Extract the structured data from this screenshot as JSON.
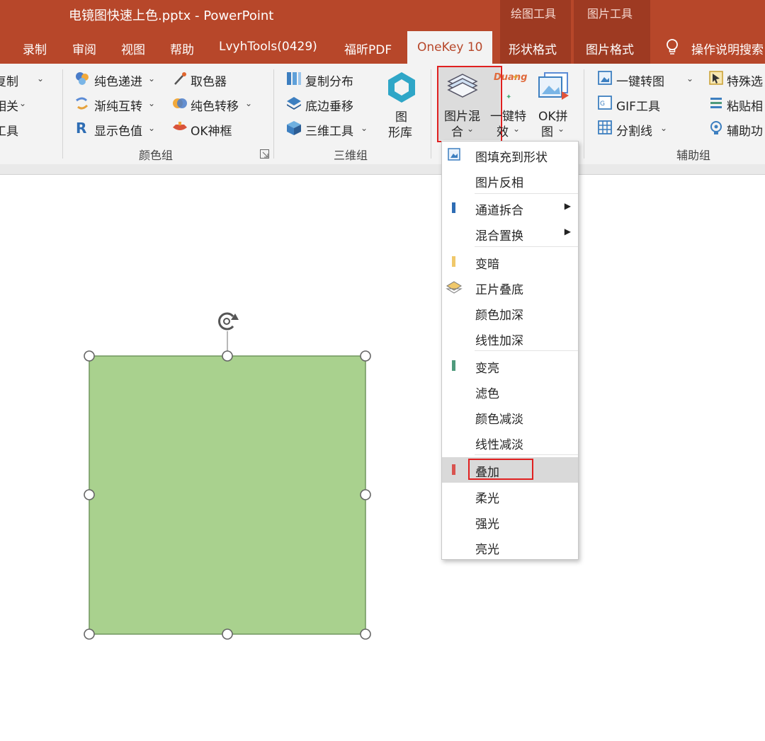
{
  "window": {
    "title": "电镜图快速上色.pptx  -  PowerPoint",
    "context_tabs": [
      "绘图工具",
      "图片工具"
    ],
    "tabs": [
      "录制",
      "审阅",
      "视图",
      "帮助",
      "LvyhTools(0429)",
      "福昕PDF",
      "OneKey 10",
      "形状格式",
      "图片格式"
    ],
    "active_tab": "OneKey 10",
    "tell_me": "操作说明搜索"
  },
  "ribbon": {
    "left_partial": [
      "复制",
      "相关",
      "工具"
    ],
    "color_group": {
      "items": [
        "纯色递进",
        "渐纯互转",
        "显示色值",
        "取色器",
        "纯色转移",
        "OK神框"
      ],
      "label": "颜色组"
    },
    "three_d_group": {
      "items": [
        "复制分布",
        "底边垂移",
        "三维工具"
      ],
      "big": [
        "图",
        "形库"
      ],
      "label": "三维组"
    },
    "image_group": {
      "blend_button": [
        "图片混",
        "合"
      ],
      "effect_button": [
        "一键特",
        "效"
      ],
      "effect_icon_text": "Duang",
      "ok_button": [
        "OK拼",
        "图"
      ]
    },
    "aux_group": {
      "items": [
        "一键转图",
        "GIF工具",
        "分割线",
        "特殊选",
        "粘贴相",
        "辅助功"
      ],
      "label": "辅助组"
    }
  },
  "menu": {
    "items": [
      {
        "label": "图填充到形状"
      },
      {
        "label": "图片反相"
      },
      {
        "label": "通道拆合"
      },
      {
        "label": "混合置换"
      },
      {
        "label": "变暗"
      },
      {
        "label": "正片叠底"
      },
      {
        "label": "颜色加深"
      },
      {
        "label": "线性加深"
      },
      {
        "label": "变亮"
      },
      {
        "label": "滤色"
      },
      {
        "label": "颜色减淡"
      },
      {
        "label": "线性减淡"
      },
      {
        "label": "叠加"
      },
      {
        "label": "柔光"
      },
      {
        "label": "强光"
      },
      {
        "label": "亮光"
      }
    ],
    "highlighted": "叠加"
  },
  "colors": {
    "accent": "#b7472a",
    "shape_fill": "#a9d18e",
    "shape_border": "#70965e",
    "blue_bar": "#2e6db4",
    "yellow_bar": "#f0c86a",
    "teal_bar": "#4e9a7c",
    "red_bar": "#d9534f",
    "callout": "#e02020"
  }
}
